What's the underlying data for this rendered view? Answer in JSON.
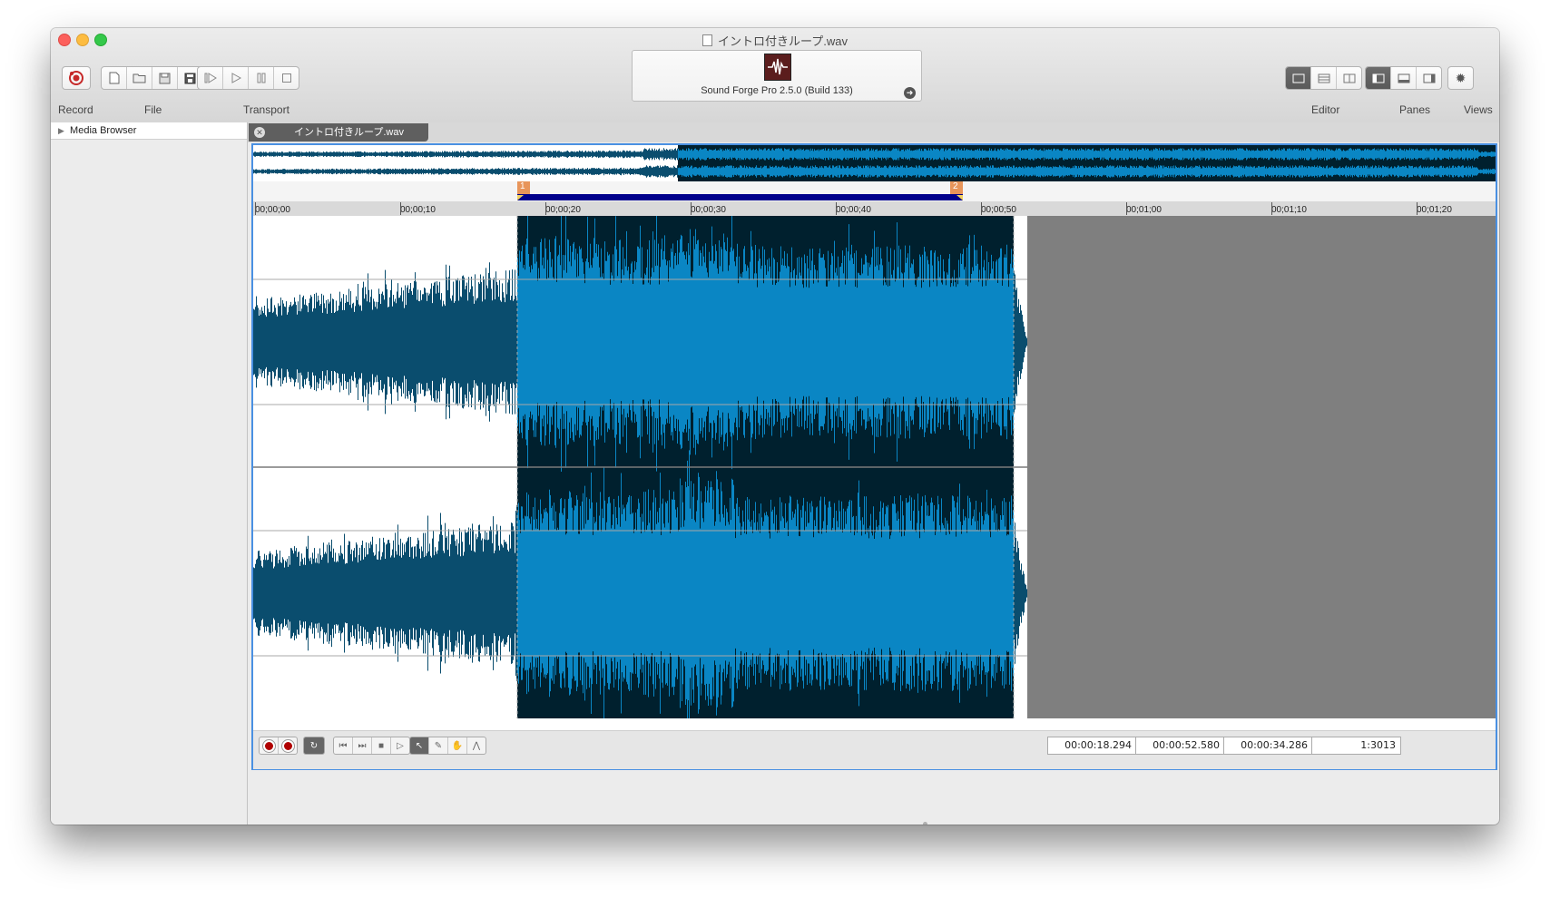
{
  "window": {
    "title": "イントロ付きループ.wav"
  },
  "toolbar": {
    "labels": {
      "record": "Record",
      "file": "File",
      "transport": "Transport",
      "editor": "Editor",
      "panes": "Panes",
      "views": "Views"
    },
    "record_button_icon": "record-icon",
    "file_buttons": [
      "new-file-icon",
      "open-file-icon",
      "save-icon",
      "save-as-icon"
    ],
    "transport_buttons": [
      "play-from-start-icon",
      "play-icon",
      "pause-icon",
      "stop-icon"
    ],
    "editor_buttons": [
      "single-view-icon",
      "multi-track-icon",
      "split-view-icon"
    ],
    "panes_buttons": [
      "left-pane-icon",
      "bottom-pane-icon",
      "right-pane-icon"
    ],
    "views_button": "gear-icon"
  },
  "display": {
    "product": "Sound Forge Pro 2.5.0 (Build 133)"
  },
  "sidebar": {
    "items": [
      "Media Browser"
    ]
  },
  "tabs": [
    {
      "label": "イントロ付きループ.wav"
    }
  ],
  "ruler": {
    "ticks": [
      "00;00;00",
      "00;00;10",
      "00;00;20",
      "00;00;30",
      "00;00;40",
      "00;00;50",
      "00;01;00",
      "00;01;10",
      "00;01;20"
    ]
  },
  "markers": {
    "start_label": "1",
    "end_label": "2"
  },
  "selection": {
    "start": "00:00:18.294",
    "end": "00:00:52.580",
    "length": "00:00:34.286",
    "zoom": "1:3013"
  },
  "colors": {
    "waveform": "#0a4d6e",
    "waveform_selected": "#0a86c4",
    "selection_bg": "#00202e",
    "empty_area": "#7f7f7f",
    "accent": "#4a90e2",
    "marker": "#e8955a",
    "loop_bar": "#00008b"
  }
}
